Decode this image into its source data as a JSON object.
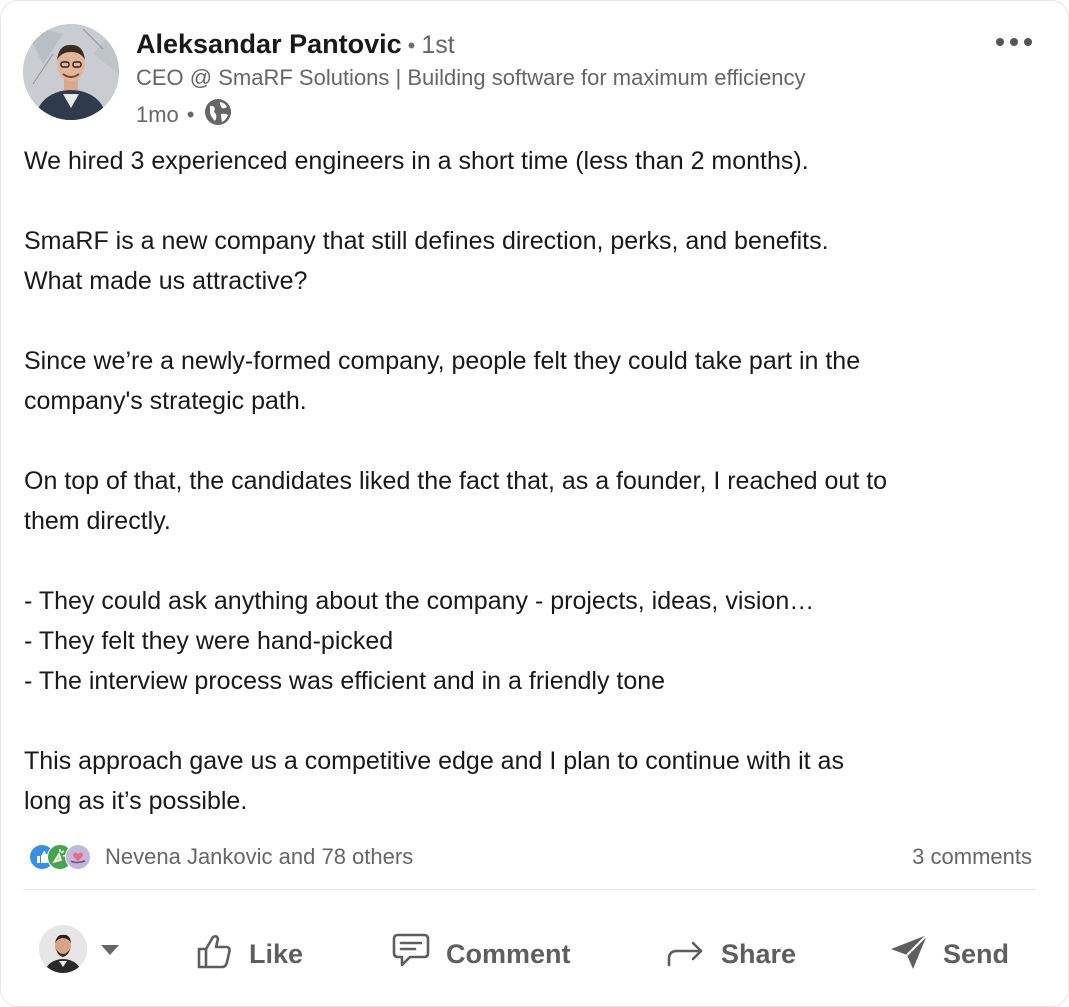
{
  "post": {
    "author": {
      "name": "Aleksandar Pantovic",
      "degree": "1st",
      "headline": "CEO @ SmaRF Solutions | Building software for maximum efficiency",
      "time": "1mo",
      "visibility_icon": "globe-icon"
    },
    "paragraphs": [
      [
        "We hired 3 experienced engineers in a short time (less than 2 months)."
      ],
      [
        "SmaRF is a new company that still defines direction, perks, and benefits.",
        "What made us attractive?"
      ],
      [
        "Since we’re a newly-formed company, people felt they could take part in the",
        "company's strategic path."
      ],
      [
        "On top of that, the candidates liked the fact that, as a founder, I reached out to",
        "them directly."
      ],
      [
        "- They could ask anything about the company - projects, ideas, vision…",
        "- They felt they were hand-picked",
        "- The interview process was efficient and in a friendly tone"
      ],
      [
        "This approach gave us a competitive edge and I plan to continue with it as",
        "long as it’s possible."
      ]
    ],
    "social": {
      "reactions_text": "Nevena Jankovic and 78 others",
      "comments_text": "3 comments",
      "reaction_icons": [
        "like-icon",
        "celebrate-icon",
        "support-icon"
      ]
    },
    "actions": {
      "like": "Like",
      "comment": "Comment",
      "share": "Share",
      "send": "Send"
    }
  }
}
